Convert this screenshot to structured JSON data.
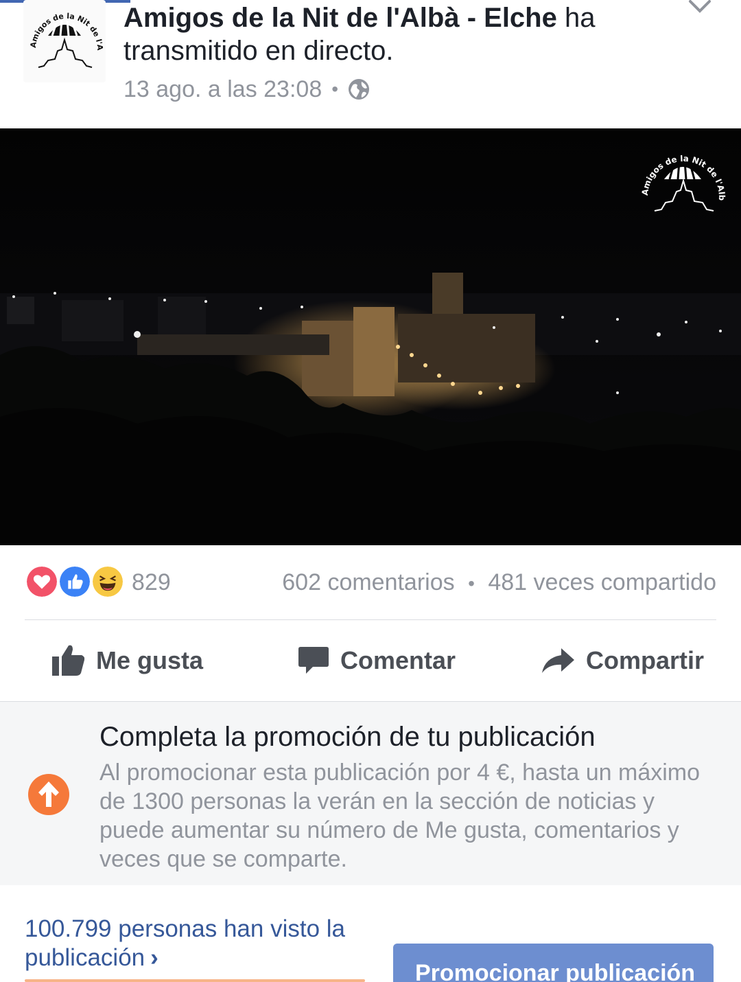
{
  "post": {
    "page_name": "Amigos de la Nit de l'Albà - Elche",
    "action_text": " ha transmitido en directo.",
    "timestamp": "13 ago. a las 23:08",
    "separator": "•",
    "audience_icon": "globe-icon",
    "avatar_text": "Amigos de la Nit de l'Albà - Elche"
  },
  "video": {
    "watermark_text": "Amigos de la Nit de l'Albà - Elche"
  },
  "reactions": {
    "icons": [
      "love-reaction-icon",
      "like-reaction-icon",
      "haha-reaction-icon"
    ],
    "count": "829",
    "comments": "602 comentarios",
    "dot": "•",
    "shares": "481 veces compartido"
  },
  "actions": {
    "like_label": "Me gusta",
    "comment_label": "Comentar",
    "share_label": "Compartir"
  },
  "promotion": {
    "title": "Completa la promoción de tu publicación",
    "body": "Al promocionar esta publicación por 4 €, hasta un máximo de 1300 personas la verán en la sección de noticias y puede aumentar su número de Me gusta, comentarios y veces que se comparte.",
    "icon": "arrow-up-circle-icon",
    "accent_color": "#f5793a"
  },
  "bottom": {
    "views_text": "100.799 personas han visto la publicación",
    "views_chevron": "›",
    "promote_button": "Promocionar publicación",
    "link_color": "#365899",
    "button_color": "#6d8ed0"
  }
}
